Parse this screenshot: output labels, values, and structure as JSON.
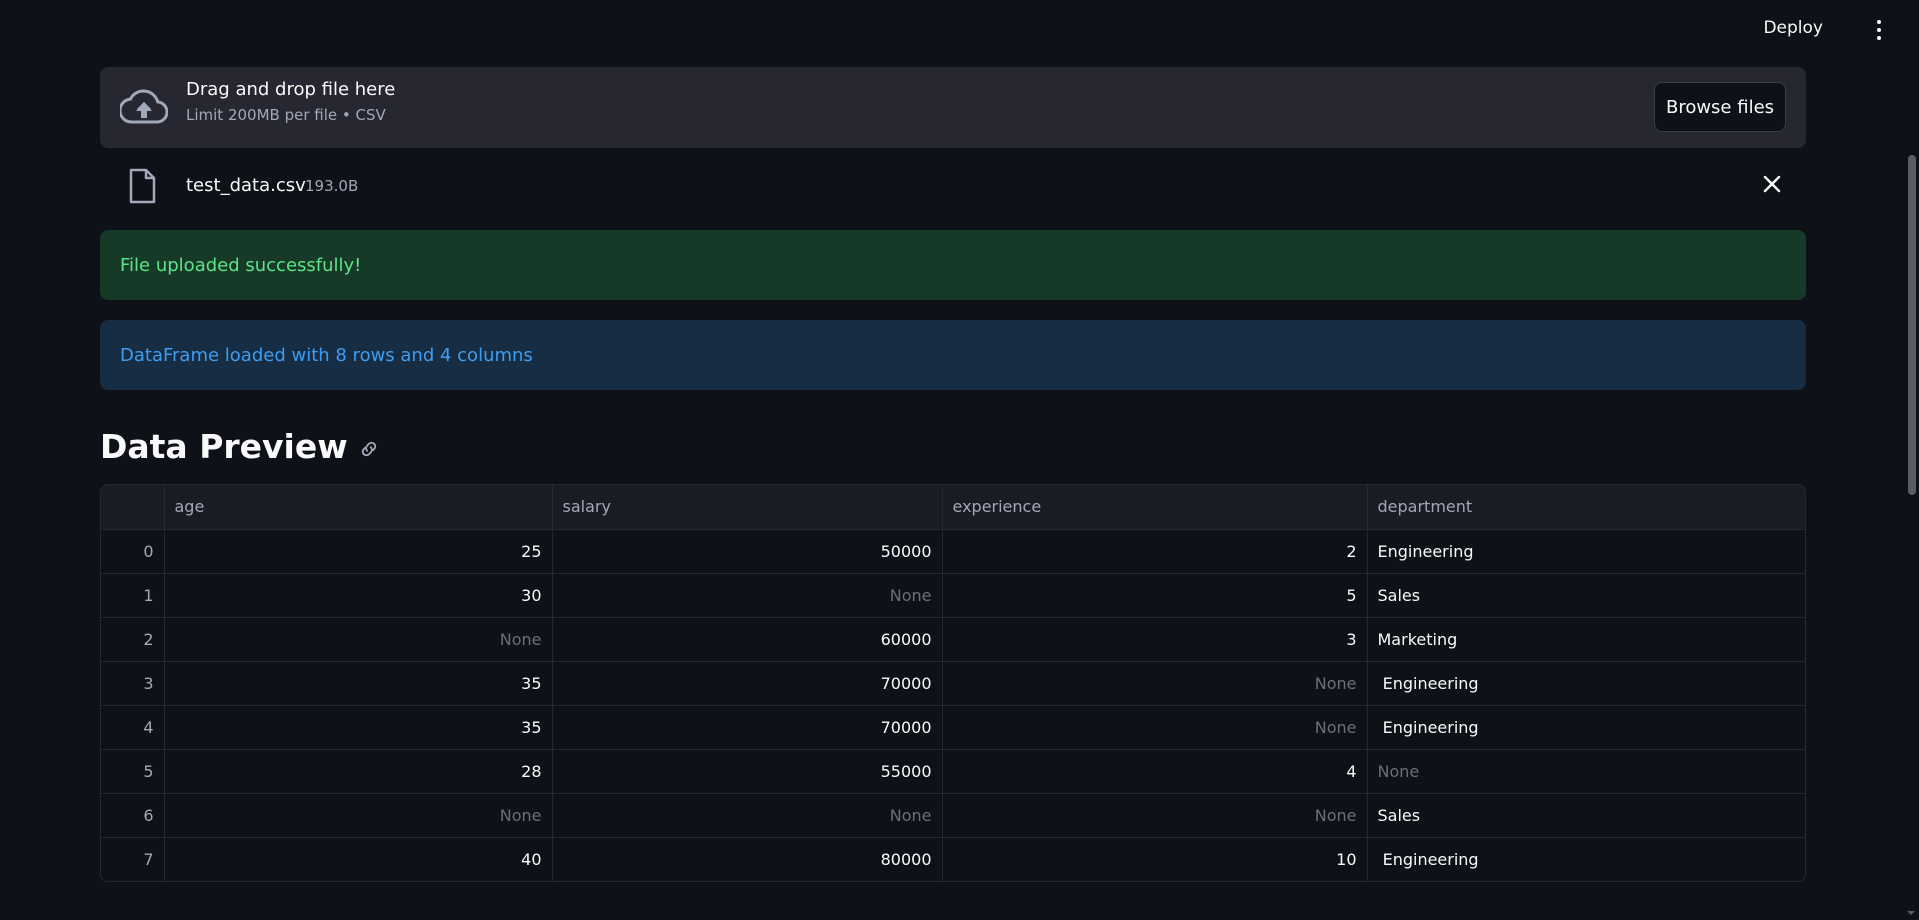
{
  "header": {
    "deploy_label": "Deploy",
    "menu_icon": "kebab-menu-icon"
  },
  "uploader": {
    "icon": "cloud-upload-icon",
    "title": "Drag and drop file here",
    "limit": "Limit 200MB per file • CSV",
    "browse_label": "Browse files"
  },
  "uploaded_file": {
    "icon": "file-icon",
    "name": "test_data.csv",
    "size": "193.0B",
    "remove_icon": "close-icon"
  },
  "alerts": {
    "success": "File uploaded successfully!",
    "info": "DataFrame loaded with 8 rows and 4 columns"
  },
  "section": {
    "title": "Data Preview",
    "anchor_icon": "link-icon"
  },
  "table": {
    "columns": [
      "",
      "age",
      "salary",
      "experience",
      "department"
    ],
    "rows": [
      [
        "0",
        "25",
        "50000",
        "2",
        "Engineering"
      ],
      [
        "1",
        "30",
        "None",
        "5",
        "Sales"
      ],
      [
        "2",
        "None",
        "60000",
        "3",
        "Marketing"
      ],
      [
        "3",
        "35",
        "70000",
        "None",
        " Engineering"
      ],
      [
        "4",
        "35",
        "70000",
        "None",
        " Engineering"
      ],
      [
        "5",
        "28",
        "55000",
        "4",
        "None"
      ],
      [
        "6",
        "None",
        "None",
        "None",
        "Sales"
      ],
      [
        "7",
        "40",
        "80000",
        "10",
        " Engineering"
      ]
    ]
  },
  "colors": {
    "background": "#0e1117",
    "success_bg": "#173928",
    "success_text": "#5ce488",
    "info_bg": "#172d43",
    "info_text": "#3d9df3"
  }
}
